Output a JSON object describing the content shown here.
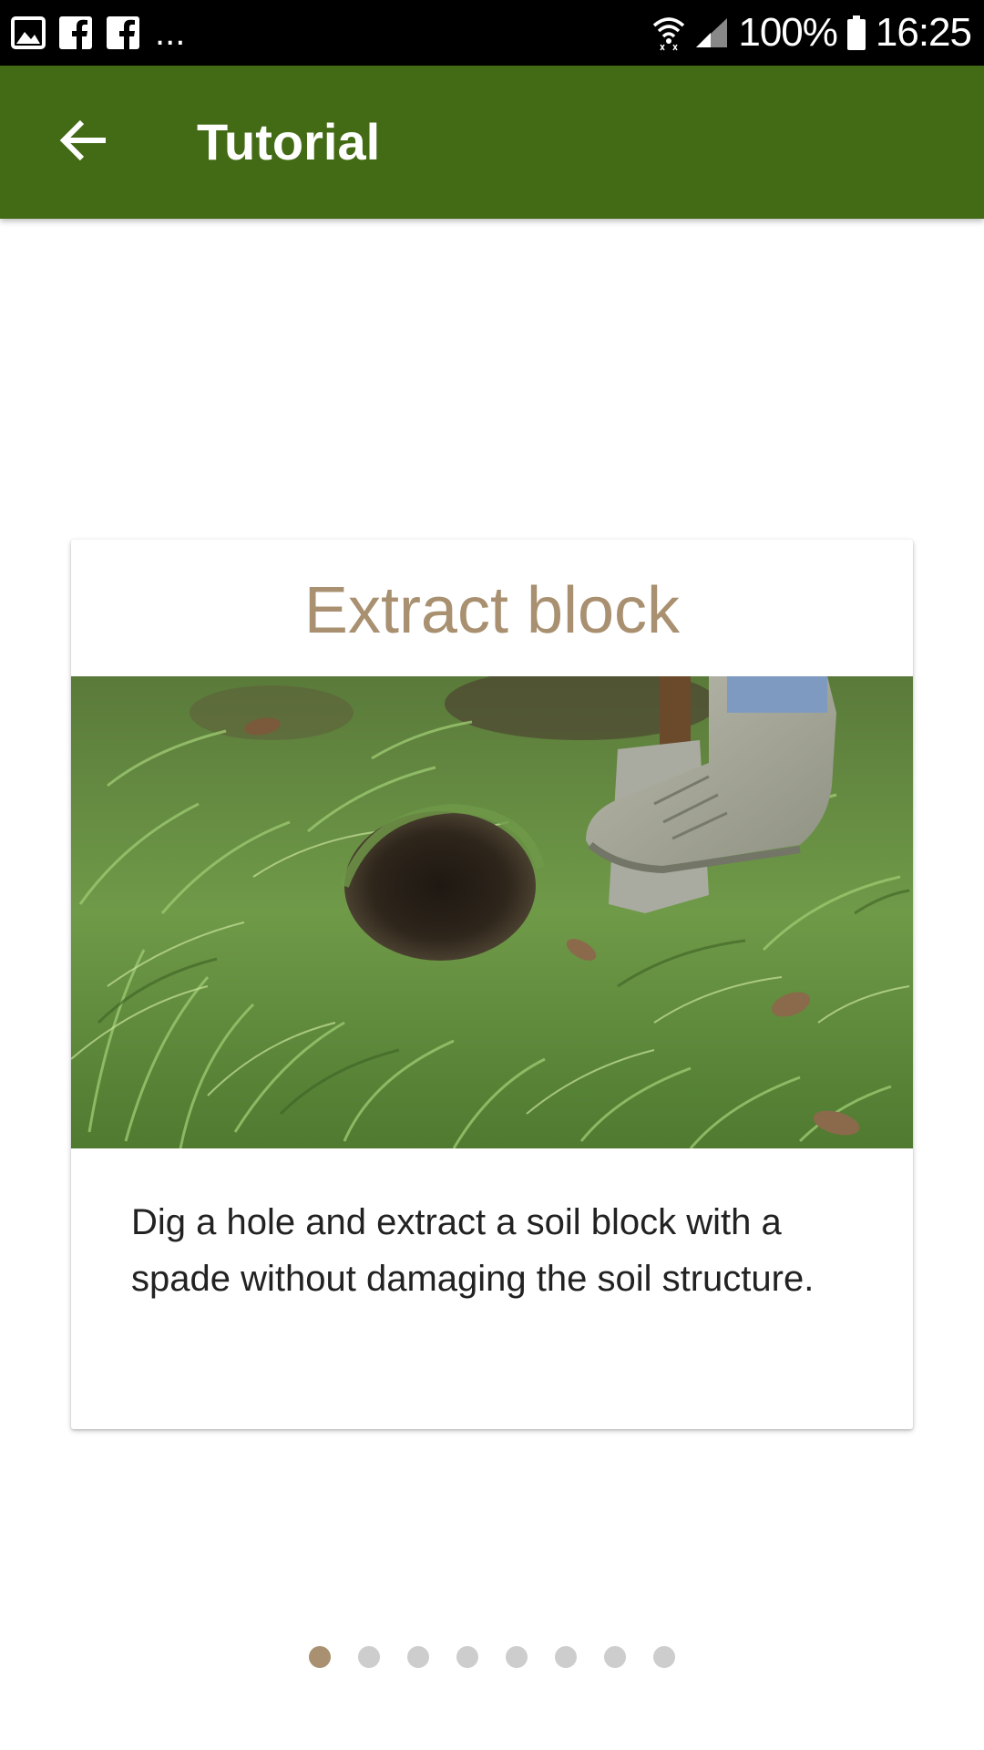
{
  "status_bar": {
    "left_icons": [
      "image-icon",
      "facebook-icon",
      "facebook-icon"
    ],
    "more": "...",
    "battery": "100%",
    "time": "16:25",
    "right_icons": [
      "wifi-icon",
      "signal-icon",
      "battery-icon"
    ]
  },
  "app_bar": {
    "title": "Tutorial",
    "back_icon": "arrow-left-icon",
    "color": "#436b16"
  },
  "card": {
    "title": "Extract block",
    "title_color": "#a89070",
    "image": "photo of a boot pressing a spade into grass beside a dug hole",
    "description": "Dig a hole and extract a soil block with a spade without damaging the soil structure."
  },
  "pager": {
    "total_pages": 8,
    "current_page": 1,
    "active_color": "#a89070",
    "inactive_color": "#cdcdcd"
  }
}
